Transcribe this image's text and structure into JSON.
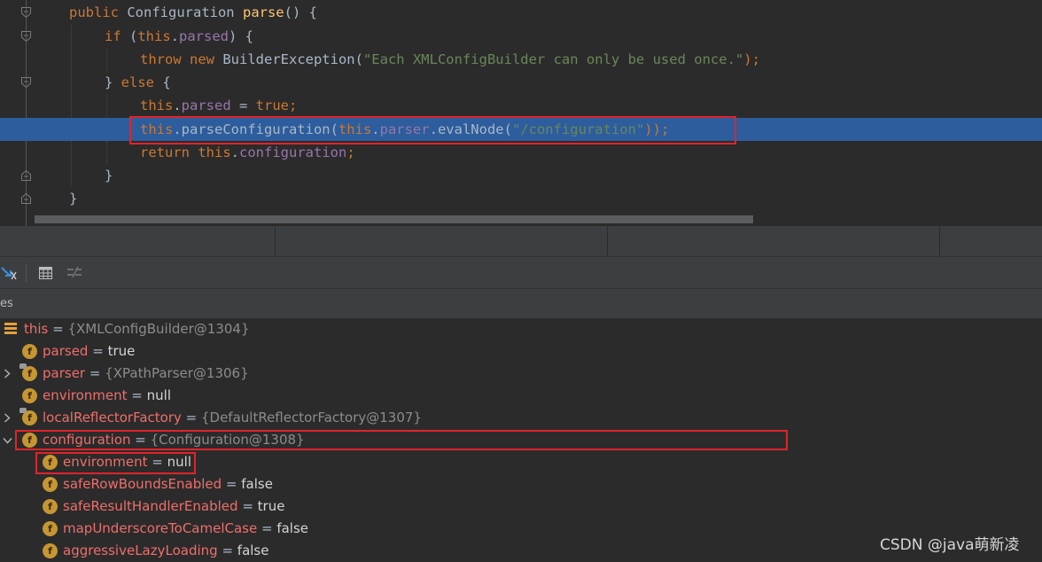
{
  "editor": {
    "lines": [
      [
        {
          "t": "public ",
          "c": "kw"
        },
        {
          "t": "Configuration ",
          "c": "plain"
        },
        {
          "t": "parse",
          "c": "fn"
        },
        {
          "t": "() {",
          "c": "plain"
        }
      ],
      [
        {
          "t": "if ",
          "c": "kw"
        },
        {
          "t": "(",
          "c": "plain"
        },
        {
          "t": "this",
          "c": "kw"
        },
        {
          "t": ".",
          "c": "plain"
        },
        {
          "t": "parsed",
          "c": "fld"
        },
        {
          "t": ") {",
          "c": "plain"
        }
      ],
      [
        {
          "t": "throw new ",
          "c": "kw"
        },
        {
          "t": "BuilderException(",
          "c": "plain"
        },
        {
          "t": "\"Each XMLConfigBuilder can only be used once.\"",
          "c": "str"
        },
        {
          "t": ");",
          "c": "kw"
        }
      ],
      [
        {
          "t": "} ",
          "c": "plain"
        },
        {
          "t": "else ",
          "c": "kw"
        },
        {
          "t": "{",
          "c": "plain"
        }
      ],
      [
        {
          "t": "this",
          "c": "kw"
        },
        {
          "t": ".",
          "c": "plain"
        },
        {
          "t": "parsed",
          "c": "fld"
        },
        {
          "t": " = ",
          "c": "plain"
        },
        {
          "t": "true",
          "c": "kw"
        },
        {
          "t": ";",
          "c": "kw"
        }
      ],
      [
        {
          "t": "this",
          "c": "kw"
        },
        {
          "t": ".parseConfiguration(",
          "c": "plain"
        },
        {
          "t": "this",
          "c": "kw"
        },
        {
          "t": ".",
          "c": "plain"
        },
        {
          "t": "parser",
          "c": "fld"
        },
        {
          "t": ".evalNode(",
          "c": "plain"
        },
        {
          "t": "\"/configuration\"",
          "c": "str"
        },
        {
          "t": "));",
          "c": "kw"
        }
      ],
      [
        {
          "t": "return ",
          "c": "kw"
        },
        {
          "t": "this",
          "c": "kw"
        },
        {
          "t": ".",
          "c": "plain"
        },
        {
          "t": "configuration",
          "c": "fld"
        },
        {
          "t": ";",
          "c": "kw"
        }
      ],
      [
        {
          "t": "}",
          "c": "plain"
        }
      ],
      [
        {
          "t": "}",
          "c": "plain"
        }
      ]
    ]
  },
  "debugger": {
    "panel_label": "es"
  },
  "variables": [
    {
      "name": "this",
      "value": "{XMLConfigBuilder@1304}",
      "ref": true
    },
    {
      "name": "parsed",
      "value": "true",
      "ref": false
    },
    {
      "name": "parser",
      "value": "{XPathParser@1306}",
      "ref": true
    },
    {
      "name": "environment",
      "value": "null",
      "ref": false
    },
    {
      "name": "localReflectorFactory",
      "value": "{DefaultReflectorFactory@1307}",
      "ref": true
    },
    {
      "name": "configuration",
      "value": "{Configuration@1308}",
      "ref": true
    },
    {
      "name": "environment",
      "value": "null",
      "ref": false
    },
    {
      "name": "safeRowBoundsEnabled",
      "value": "false",
      "ref": false
    },
    {
      "name": "safeResultHandlerEnabled",
      "value": "true",
      "ref": false
    },
    {
      "name": "mapUnderscoreToCamelCase",
      "value": "false",
      "ref": false
    },
    {
      "name": "aggressiveLazyLoading",
      "value": "false",
      "ref": false
    }
  ],
  "field_icon_letter": "f",
  "equals": " = ",
  "watermark": "CSDN @java萌新凌",
  "colors": {
    "keyword": "#cc7832",
    "method": "#ffc66d",
    "field": "#9876aa",
    "string": "#6a8759",
    "execution_line": "#2d5d9c",
    "highlight_box": "#e0242b"
  }
}
